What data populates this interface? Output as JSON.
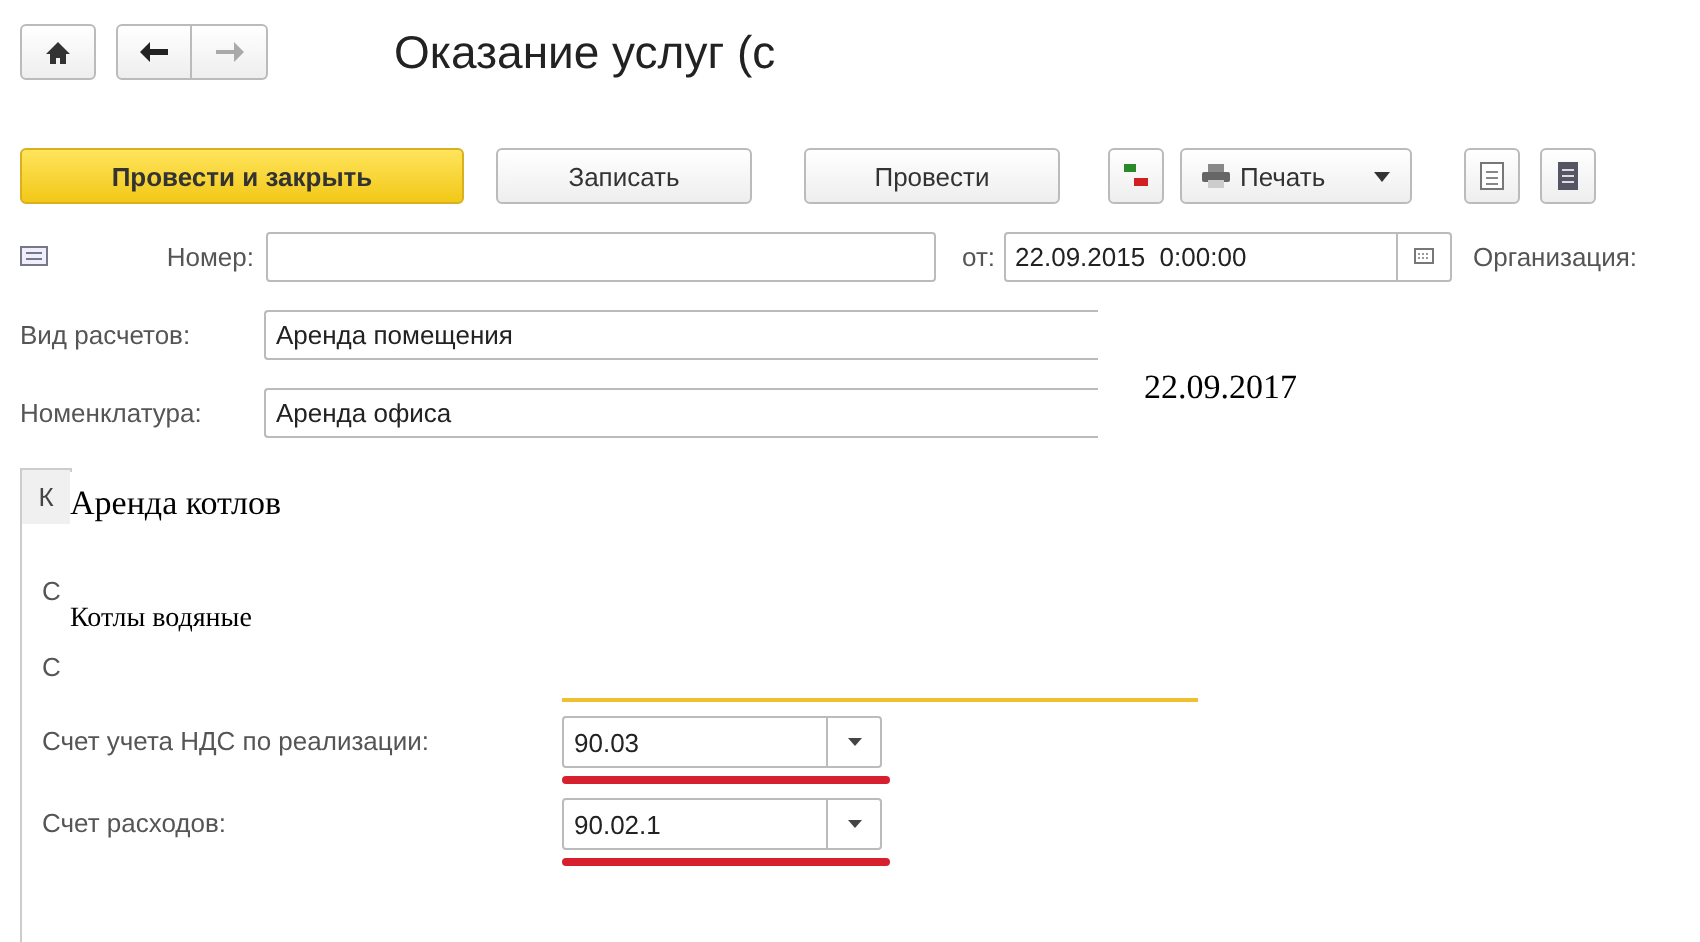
{
  "title": "Оказание услуг (с",
  "toolbar": [
    {
      "label": "Провести и закрыть",
      "kind": "primary"
    },
    {
      "label": "Записать",
      "kind": "normal"
    },
    {
      "label": "Провести",
      "kind": "normal"
    }
  ],
  "print_button": "Печать",
  "number_field": {
    "label": "Номер:",
    "date_label": "от:",
    "date_value": "22.09.2015  0:00:00",
    "org_label": "Организация:"
  },
  "fields": [
    {
      "label": "Вид расчетов:",
      "value": "Аренда помещения"
    },
    {
      "label": "Номенклатура:",
      "value": "Аренда офиса"
    }
  ],
  "tab": {
    "label": "К"
  },
  "cut_labels": [
    "С",
    "С"
  ],
  "accounts": [
    {
      "label": "Счет учета НДС по реализации:",
      "value": "90.03",
      "highlighted": true
    },
    {
      "label": "Счет расходов:",
      "value": "90.02.1",
      "highlighted": true
    }
  ],
  "overlays": [
    {
      "text": "22.09.2017"
    },
    {
      "text": "Аренда котлов"
    },
    {
      "text": "Котлы водяные"
    }
  ]
}
